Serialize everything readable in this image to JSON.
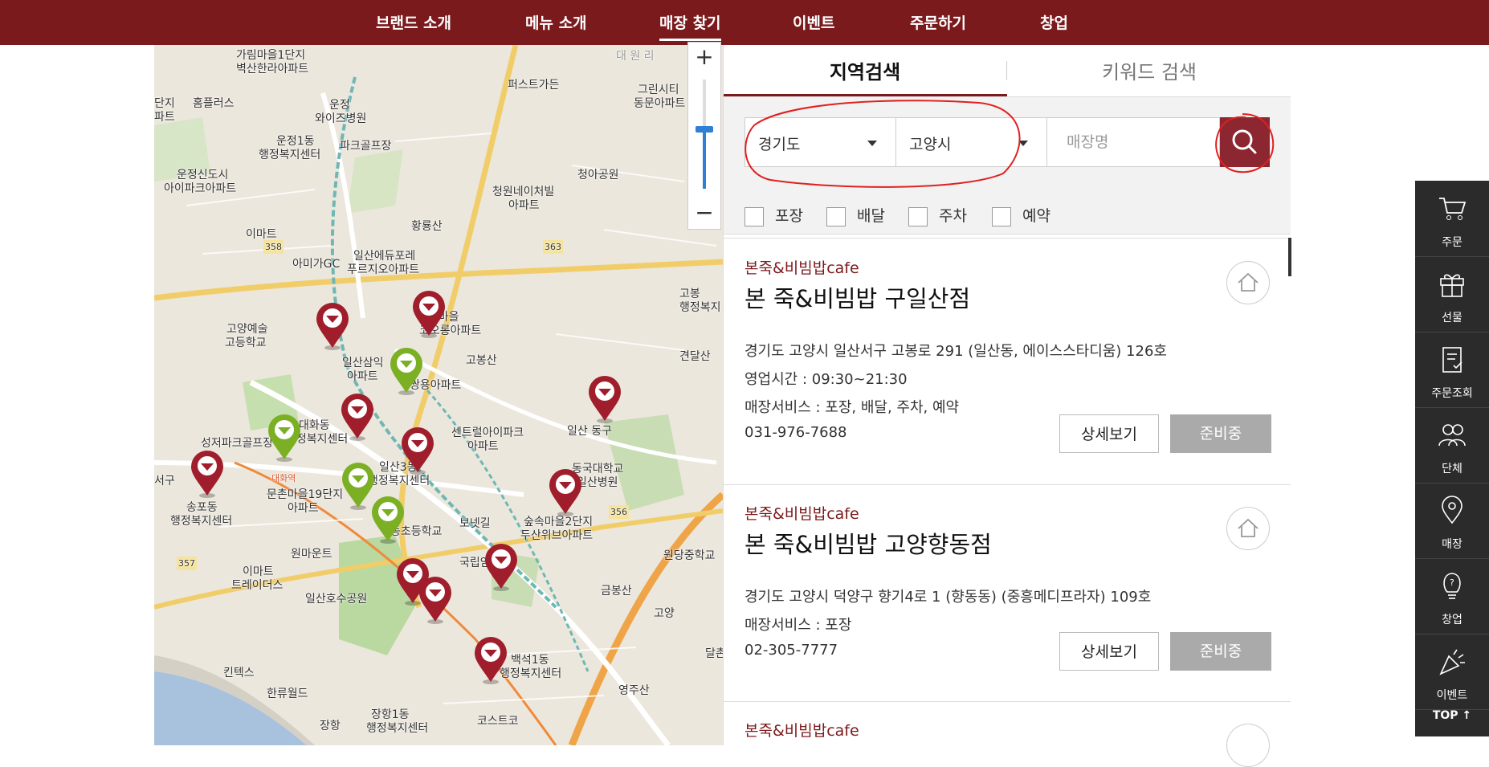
{
  "nav": {
    "items": [
      "브랜드 소개",
      "메뉴 소개",
      "매장 찾기",
      "이벤트",
      "주문하기",
      "창업"
    ],
    "active": "매장 찾기"
  },
  "map": {
    "labels": [
      "가림마을1단지",
      "벽산한라아파트",
      "홈플러스",
      "운정",
      "와이즈병원",
      "단지",
      "파트",
      "퍼스트가든",
      "대 원 리",
      "그린시티",
      "동문아파트",
      "운정1동",
      "행정복지센터",
      "파크골프장",
      "운정신도시",
      "아이파크아파트",
      "청아공원",
      "청원네이처빌",
      "아파트",
      "황룡산",
      "이마트",
      "아미가GC",
      "일산에듀포레",
      "푸르지오아파트",
      "363",
      "358",
      "중산마을",
      "코오롱아파트",
      "고양예술",
      "고등학교",
      "일산삼익",
      "아파트",
      "고봉산",
      "쌍용아파트",
      "견달산",
      "대화동",
      "행정복지센터",
      "성저파크골프장",
      "센트럴아이파크",
      "아파트",
      "일산 동구",
      "서구",
      "송포동",
      "행정복지센터",
      "일산3동",
      "행정복지센터",
      "동국대학교",
      "일산병원",
      "문촌마을19단지",
      "아파트",
      "동초등학교",
      "보넷길",
      "숲속마을2단지",
      "두산위브아파트",
      "356",
      "원당중학교",
      "원마운트",
      "357",
      "이마트",
      "트레이더스",
      "국립암센",
      "금봉산",
      "일산호수공원",
      "고양",
      "킨텍스",
      "한류월드",
      "백석1동",
      "행정복지센터",
      "영주산",
      "장항1동",
      "행정복지센터",
      "코스트코",
      "장항",
      "고봉",
      "행정복지",
      "달촌",
      "대화역"
    ]
  },
  "search": {
    "tabs": [
      "지역검색",
      "키워드 검색"
    ],
    "active_tab": "지역검색",
    "province": "경기도",
    "city": "고양시",
    "store_placeholder": "매장명",
    "store_value": ""
  },
  "filters": [
    "포장",
    "배달",
    "주차",
    "예약"
  ],
  "stores": [
    {
      "brand": "본죽&비빔밥cafe",
      "name": "본 죽&비빔밥 구일산점",
      "address": "경기도 고양시 일산서구 고봉로 291 (일산동, 에이스스타디움) 126호",
      "hours": "영업시간 : 09:30~21:30",
      "services": "매장서비스 : 포장, 배달, 주차, 예약",
      "phone": "031-976-7688",
      "detail_label": "상세보기",
      "status_label": "준비중"
    },
    {
      "brand": "본죽&비빔밥cafe",
      "name": "본 죽&비빔밥 고양향동점",
      "address": "경기도 고양시 덕양구 향기4로 1 (향동동) (중흥메디프라자) 109호",
      "services": "매장서비스 : 포장",
      "phone": "02-305-7777",
      "detail_label": "상세보기",
      "status_label": "준비중"
    },
    {
      "brand": "본죽&비빔밥cafe"
    }
  ],
  "quick_menu": {
    "items": [
      {
        "label": "주문",
        "icon": "cart-icon"
      },
      {
        "label": "선물",
        "icon": "gift-icon"
      },
      {
        "label": "주문조회",
        "icon": "clipboard-check-icon"
      },
      {
        "label": "단체",
        "icon": "group-icon"
      },
      {
        "label": "매장",
        "icon": "location-pin-icon"
      },
      {
        "label": "창업",
        "icon": "lightbulb-icon"
      },
      {
        "label": "이벤트",
        "icon": "party-popper-icon"
      }
    ],
    "top_label": "TOP ↑"
  },
  "colors": {
    "brand_red": "#7b1a1c",
    "pin_red": "#a01e2c",
    "pin_green": "#7bb025",
    "search_button": "#8c2630",
    "ready_button": "#aaaaaa"
  }
}
